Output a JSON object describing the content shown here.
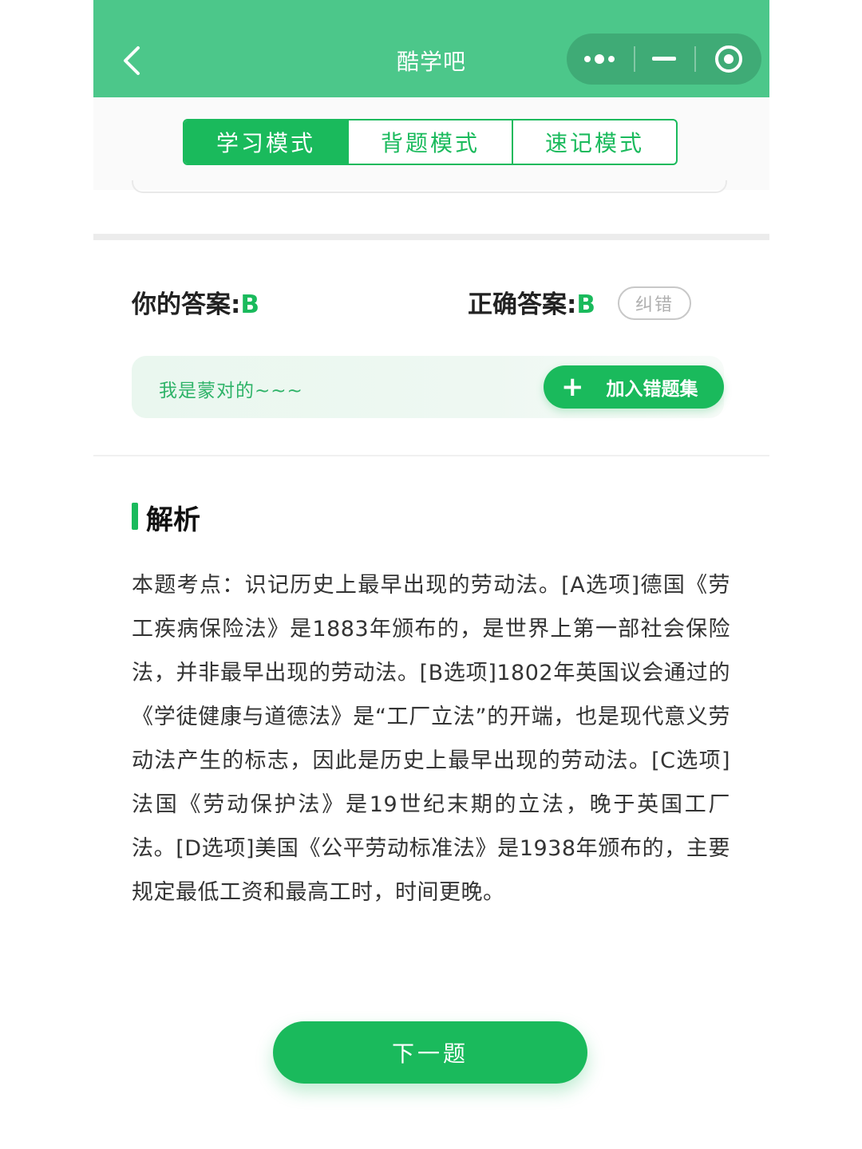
{
  "header": {
    "title": "酷学吧",
    "back_icon": "chevron-left-icon",
    "menu_icon": "more-dots-icon",
    "minimize_icon": "minus-icon",
    "close_icon": "target-circle-icon"
  },
  "modes": {
    "tabs": [
      {
        "label": "学习模式",
        "active": true
      },
      {
        "label": "背题模式",
        "active": false
      },
      {
        "label": "速记模式",
        "active": false
      }
    ]
  },
  "answer": {
    "your_label": "你的答案:",
    "your_value": "B",
    "correct_label": "正确答案:",
    "correct_value": "B",
    "report_label": "纠错"
  },
  "comment": {
    "text": "我是蒙对的~~~",
    "add_button_label": "加入错题集",
    "add_icon": "plus-icon"
  },
  "analysis": {
    "title": "解析",
    "body": "本题考点：识记历史上最早出现的劳动法。[A选项]德国《劳工疾病保险法》是1883年颁布的，是世界上第一部社会保险法，并非最早出现的劳动法。[B选项]1802年英国议会通过的《学徒健康与道德法》是“工厂立法”的开端，也是现代意义劳动法产生的标志，因此是历史上最早出现的劳动法。[C选项]法国《劳动保护法》是19世纪末期的立法，晚于英国工厂法。[D选项]美国《公平劳动标准法》是1938年颁布的，主要规定最低工资和最高工时，时间更晚。"
  },
  "footer": {
    "next_label": "下一题"
  },
  "colors": {
    "header_bg": "#4cc78a",
    "accent": "#1aba5c"
  }
}
